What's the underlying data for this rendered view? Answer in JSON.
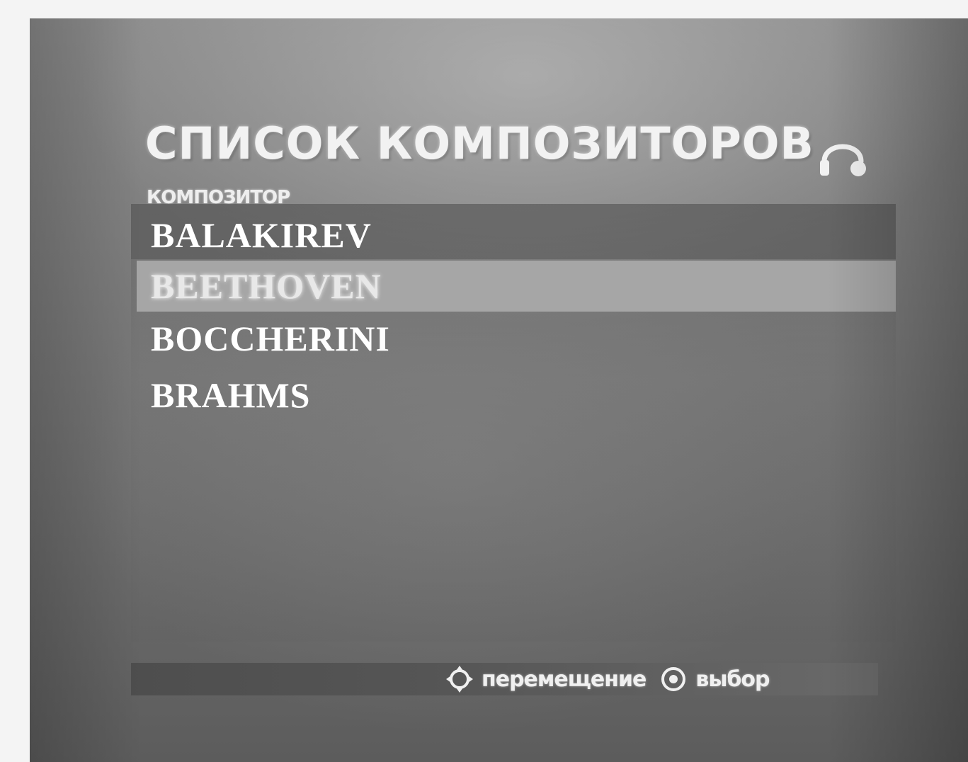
{
  "menu": {
    "title": "СПИСОК КОМПОЗИТОРОВ",
    "subtitle": "КОМПОЗИТОР",
    "mode_icon": "headphone-icon"
  },
  "composers": [
    {
      "label": "BALAKIREV",
      "selected": false
    },
    {
      "label": "BEETHOVEN",
      "selected": true
    },
    {
      "label": "BOCCHERINI",
      "selected": false
    },
    {
      "label": "BRAHMS",
      "selected": false
    }
  ],
  "footer": {
    "move_icon": "dpad-icon",
    "move_label": "перемещение",
    "select_icon": "enter-button-icon",
    "select_label": "выбор"
  },
  "colors": {
    "screen_bg": "#7c7c7c",
    "highlight": "#a6a6a6",
    "text": "#ffffff"
  }
}
